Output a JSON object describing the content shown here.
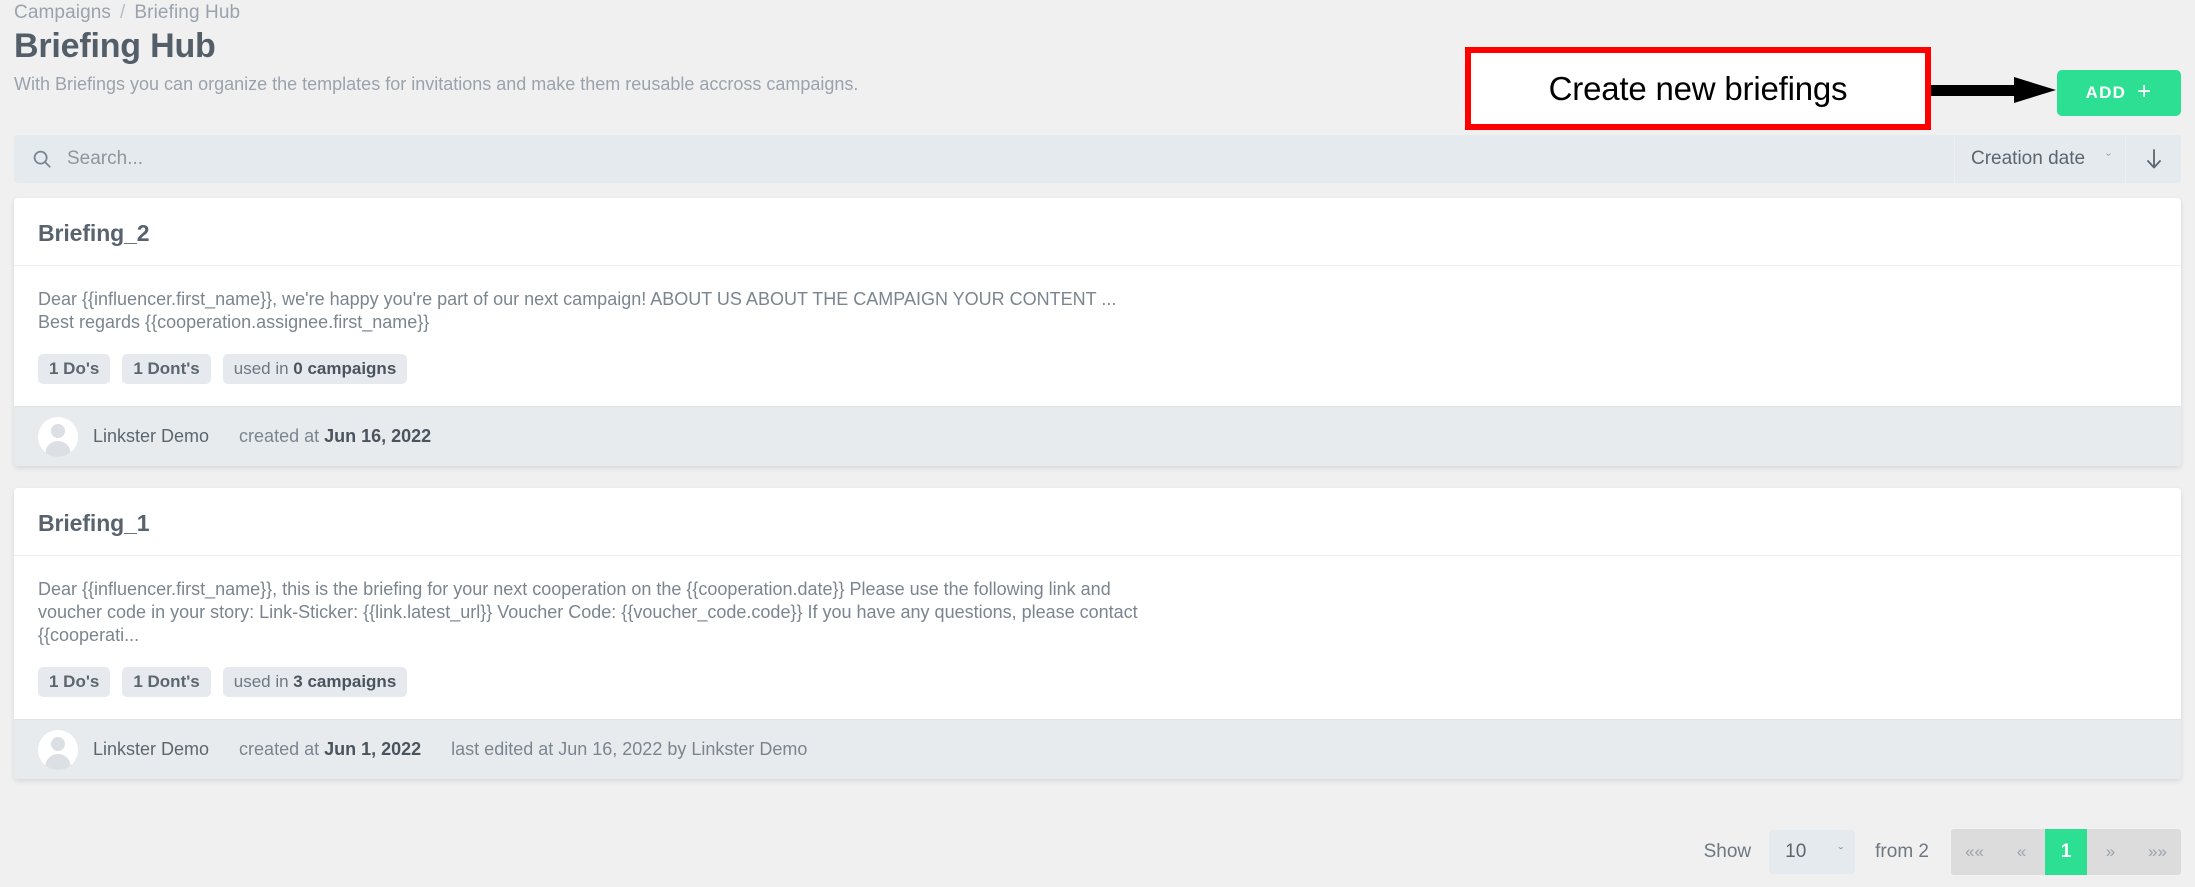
{
  "breadcrumb": {
    "items": [
      "Campaigns",
      "Briefing Hub"
    ],
    "separator": "/"
  },
  "header": {
    "title": "Briefing Hub",
    "subtitle": "With Briefings you can organize the templates for invitations and make them reusable accross campaigns.",
    "add_label": "ADD",
    "add_plus": "+"
  },
  "annotation": {
    "text": "Create new briefings",
    "box_color": "#ff0000",
    "arrow_color": "#000000"
  },
  "toolbar": {
    "search_placeholder": "Search...",
    "search_value": "",
    "search_icon": "search-icon",
    "sort_field": "Creation date",
    "sort_chevron": "ˇ",
    "sort_direction_icon": "arrow-down-icon"
  },
  "cards": [
    {
      "title": "Briefing_2",
      "text": "Dear {{influencer.first_name}}, we're happy you're part of our next campaign! ABOUT US ABOUT THE CAMPAIGN YOUR CONTENT ...\nBest regards {{cooperation.assignee.first_name}}",
      "chips": {
        "dos": "1 Do's",
        "donts": "1 Dont's",
        "usage_prefix": "used in ",
        "usage_value": "0 campaigns"
      },
      "footer": {
        "author": "Linkster Demo",
        "created_prefix": "created at ",
        "created_date": "Jun 16, 2022",
        "edited": ""
      }
    },
    {
      "title": "Briefing_1",
      "text": "Dear {{influencer.first_name}}, this is the briefing for your next cooperation on the {{cooperation.date}} Please use the following link and voucher code in your story: Link-Sticker: {{link.latest_url}} Voucher Code: {{voucher_code.code}} If you have any questions, please contact {{cooperati...",
      "chips": {
        "dos": "1 Do's",
        "donts": "1 Dont's",
        "usage_prefix": "used in ",
        "usage_value": "3 campaigns"
      },
      "footer": {
        "author": "Linkster Demo",
        "created_prefix": "created at ",
        "created_date": "Jun 1, 2022",
        "edited": "last edited at Jun 16, 2022 by Linkster Demo"
      }
    }
  ],
  "pagination": {
    "show_label": "Show",
    "page_size": "10",
    "size_chevron": "ˇ",
    "from_label": "from 2",
    "first_label": "««",
    "prev_label": "«",
    "current_page": "1",
    "next_label": "»",
    "last_label": "»»"
  },
  "colors": {
    "accent_green": "#2ddf92",
    "page_bg": "#f0f0f0",
    "toolbar_bg": "#e5eaee",
    "card_footer_bg": "#e7ebee",
    "annotation_red": "#ff0000"
  }
}
